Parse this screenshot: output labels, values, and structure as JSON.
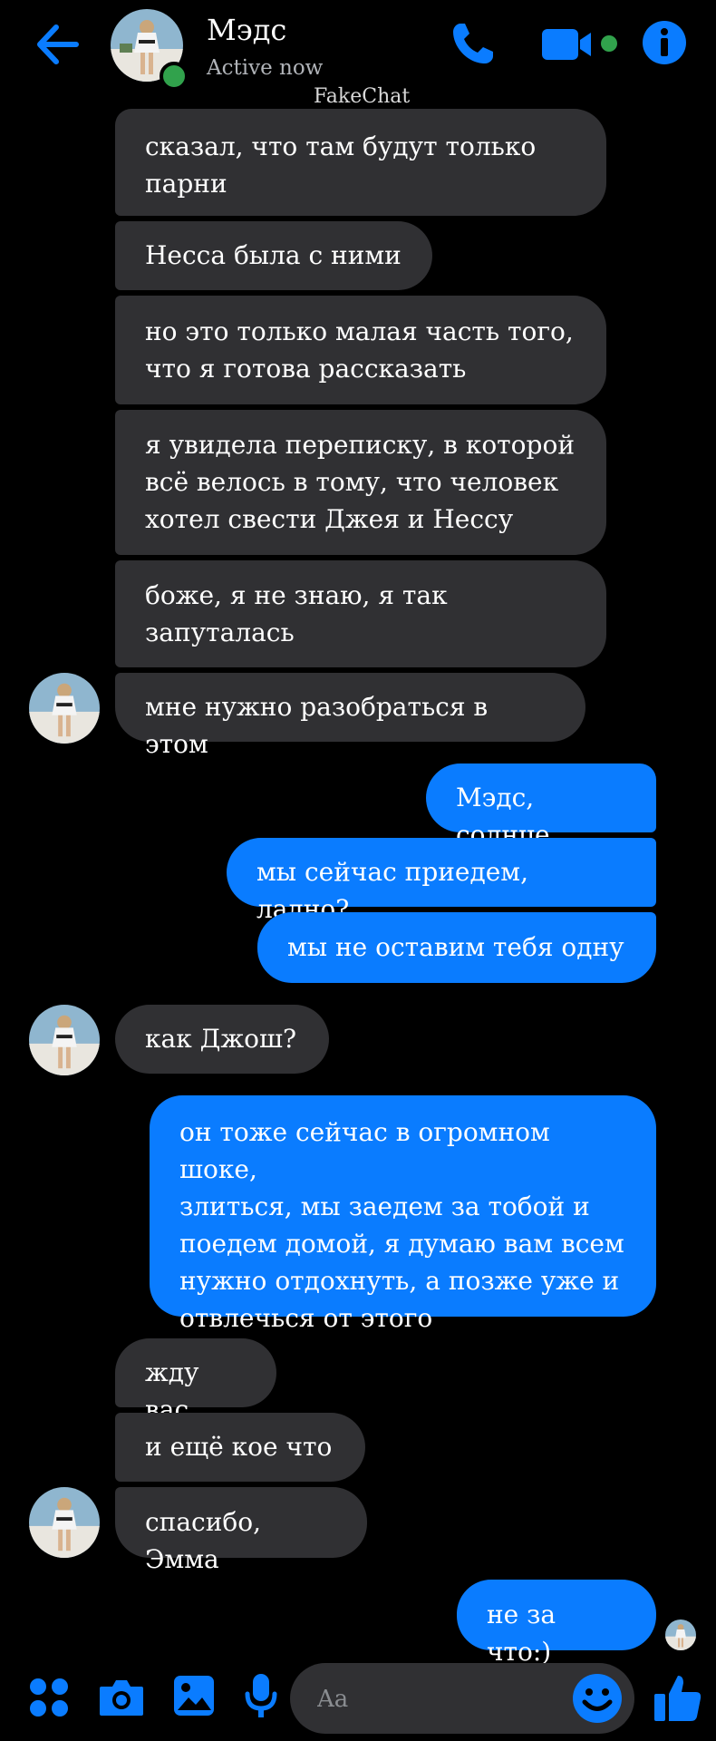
{
  "header": {
    "name": "Мэдс",
    "status": "Active now",
    "watermark": "FakeChat"
  },
  "colors": {
    "accent": "#0a7cff",
    "incoming_bubble": "#303033",
    "background": "#000000",
    "online": "#31a24c"
  },
  "icons": {
    "back": "arrow-left-icon",
    "call": "phone-icon",
    "video": "video-camera-icon",
    "info": "info-icon",
    "apps": "grid-dots-icon",
    "camera": "camera-icon",
    "gallery": "image-icon",
    "mic": "microphone-icon",
    "emoji": "smiley-icon",
    "like": "thumbs-up-icon"
  },
  "messages": [
    {
      "side": "in",
      "text": "сказал, что там будут только\nпарни"
    },
    {
      "side": "in",
      "text": "Несса была с ними"
    },
    {
      "side": "in",
      "text": "но это только малая часть того,\nчто я готова рассказать"
    },
    {
      "side": "in",
      "text": "я увидела переписку, в которой\nвсё велось в тому, что человек\nхотел свести Джея и Нессу"
    },
    {
      "side": "in",
      "text": "боже, я не знаю, я так\nзапуталась"
    },
    {
      "side": "in",
      "text": "мне нужно разобраться в этом"
    },
    {
      "side": "out",
      "text": "Мэдс, солнце"
    },
    {
      "side": "out",
      "text": "мы сейчас приедем, ладно?"
    },
    {
      "side": "out",
      "text": "мы не оставим тебя одну"
    },
    {
      "side": "in",
      "text": "как Джош?"
    },
    {
      "side": "out",
      "text": "он тоже сейчас в огромном шоке,\nзлиться, мы заедем за тобой и\nпоедем домой, я думаю вам всем\nнужно отдохнуть, а позже уже и\nотвлечься от этого"
    },
    {
      "side": "in",
      "text": "жду вас"
    },
    {
      "side": "in",
      "text": "и ещё кое что"
    },
    {
      "side": "in",
      "text": "спасибо, Эмма"
    },
    {
      "side": "out",
      "text": "не за что:)"
    }
  ],
  "composer": {
    "placeholder": "Aa"
  }
}
